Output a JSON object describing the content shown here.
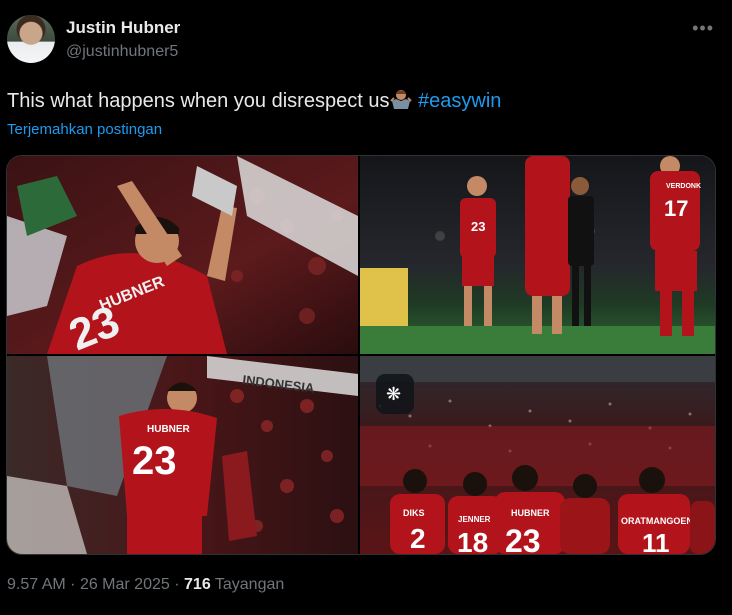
{
  "author": {
    "name": "Justin Hubner",
    "handle": "@justinhubner5"
  },
  "tweet": {
    "text": "This what happens when you disrespect us",
    "emoji_icon": "person-shrugging-emoji",
    "hashtag": "#easywin",
    "translate_label": "Terjemahkan postingan"
  },
  "media": {
    "photo_1": {
      "shirt_name": "HUBNER",
      "shirt_number": "23"
    },
    "photo_2": {
      "shirt_number_a": "23",
      "shirt_name_b": "VERDONK",
      "shirt_number_b": "17"
    },
    "photo_3": {
      "banner_text": "INDONESIA",
      "shirt_name": "HUBNER",
      "shirt_number": "23"
    },
    "photo_4": {
      "players": [
        {
          "name": "DIKS",
          "number": "2"
        },
        {
          "name": "JENNER",
          "number": "18"
        },
        {
          "name": "HUBNER",
          "number": "23"
        },
        {
          "name": "ORATMANGOEN",
          "number": "11"
        }
      ]
    }
  },
  "meta": {
    "time": "9.57 AM",
    "separator": "·",
    "date": "26 Mar 2025",
    "views_count": "716",
    "views_label": "Tayangan"
  },
  "colors": {
    "background": "#000000",
    "text": "#e7e9ea",
    "secondary": "#71767b",
    "link": "#1d9bf0",
    "jersey_red": "#b3141c"
  }
}
